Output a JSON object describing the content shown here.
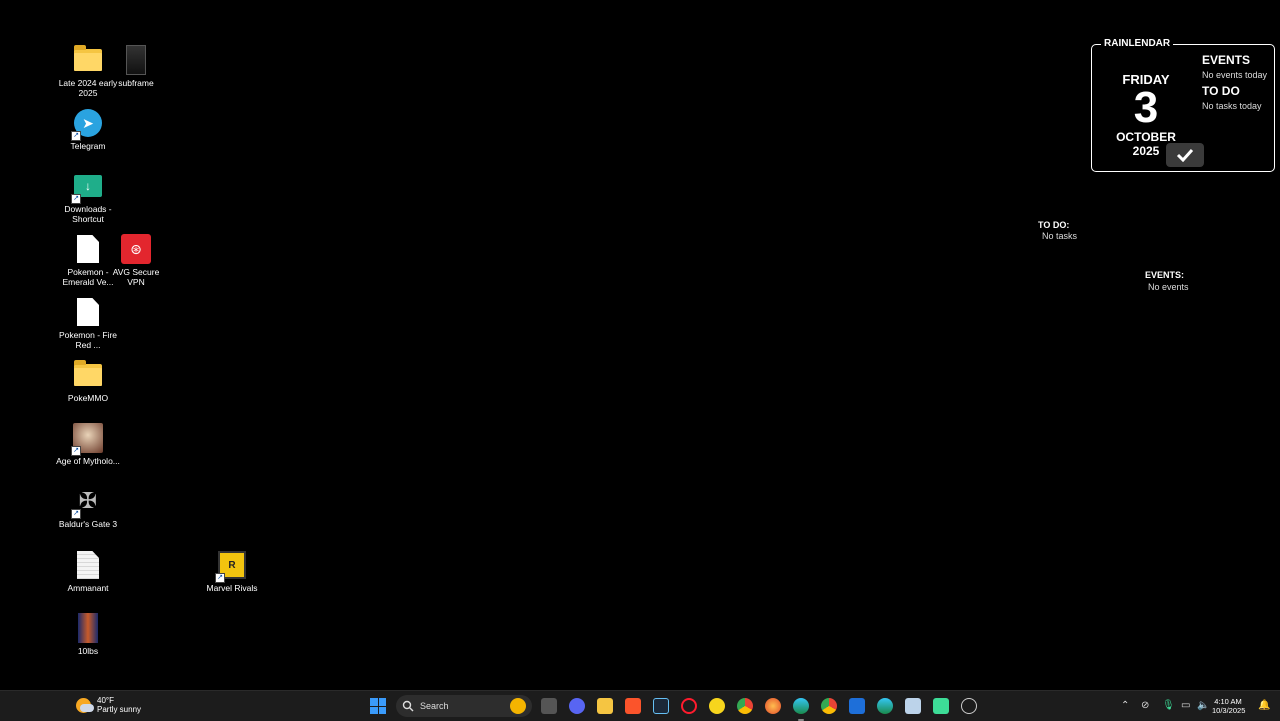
{
  "desktop": {
    "icons": [
      {
        "label": "Late 2024 early 2025"
      },
      {
        "label": "subframe"
      },
      {
        "label": "Telegram"
      },
      {
        "label": "Downloads - Shortcut"
      },
      {
        "label": "Pokemon - Emerald Ve..."
      },
      {
        "label": "AVG Secure VPN"
      },
      {
        "label": "Pokemon - Fire Red ..."
      },
      {
        "label": "PokeMMO"
      },
      {
        "label": "Age of Mytholo..."
      },
      {
        "label": "Baldur's Gate 3"
      },
      {
        "label": "Ammanant"
      },
      {
        "label": "Marvel Rivals"
      },
      {
        "label": "10lbs"
      }
    ]
  },
  "rainlendar": {
    "title": "RAINLENDAR",
    "day": "FRIDAY",
    "date": "3",
    "month": "OCTOBER",
    "year": "2025",
    "events_heading": "EVENTS",
    "events_text": "No events today",
    "todo_heading": "TO DO",
    "todo_text": "No tasks today"
  },
  "todo_panel": {
    "heading": "TO DO:",
    "text": "No tasks"
  },
  "events_panel": {
    "heading": "EVENTS:",
    "text": "No events"
  },
  "taskbar": {
    "weather_temp": "40°F",
    "weather_desc": "Partly sunny",
    "search_label": "Search",
    "apps": [
      "task-view",
      "discord",
      "file-explorer",
      "brave",
      "steam",
      "opera",
      "app-yellow",
      "chrome",
      "firefox",
      "edge",
      "chrome-alt",
      "app-blue",
      "edge-alt",
      "notepad",
      "app-green",
      "app-red"
    ],
    "time": "4:10 AM",
    "date": "10/3/2025"
  }
}
